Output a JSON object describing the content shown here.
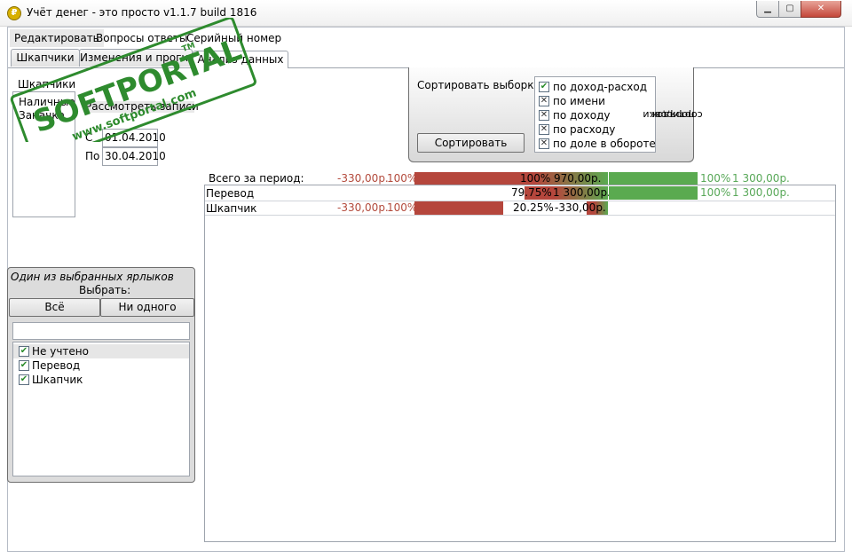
{
  "window": {
    "title": "Учёт денег - это просто v1.1.7 build 1816",
    "controls": {
      "minimize": "▁",
      "maximize": "▢",
      "close": "✕"
    }
  },
  "menu": [
    "Редактировать",
    "Вопросы ответы",
    "Серийный номер"
  ],
  "tabs": [
    {
      "label": "Шкапчики",
      "active": false
    },
    {
      "label": "Изменения и прогноз",
      "active": false
    },
    {
      "label": "Анализ данных",
      "active": true
    }
  ],
  "left_top": {
    "cards_header": "Шкапчики",
    "cards": [
      "Наличные",
      "Заначка"
    ],
    "view_label": "Рассмотреть записи",
    "from_label": "С",
    "from_value": "01.04.2010",
    "to_label": "По",
    "to_value": "30.04.2010"
  },
  "filter": {
    "title": "Один из выбранных ярлыков",
    "subtitle": "Выбрать:",
    "all_button": "Всё",
    "none_button": "Ни одного",
    "search_value": "",
    "items": [
      {
        "label": "Не учтено",
        "checked": true
      },
      {
        "label": "Перевод",
        "checked": true
      },
      {
        "label": "Шкапчик",
        "checked": true
      }
    ]
  },
  "sort": {
    "title": "Сортировать выборку",
    "button": "Сортировать",
    "options": [
      {
        "label": "по доход-расход",
        "state": "checked"
      },
      {
        "label": "по имени",
        "state": "crossed"
      },
      {
        "label": "по доходу",
        "state": "crossed"
      },
      {
        "label": "по расходу",
        "state": "crossed"
      },
      {
        "label": "по доле в обороте",
        "state": "crossed"
      }
    ],
    "order_label_1": "порядок",
    "order_label_2": "сортировки"
  },
  "table": {
    "total": {
      "name": "Всего за период:",
      "expense": "-330,00р.",
      "expense_pct": "100%",
      "share_pct": "100%",
      "balance": "970,00р.",
      "income_pct": "100%",
      "income": "1 300,00р."
    },
    "rows": [
      {
        "name": "Перевод",
        "expense": "",
        "expense_pct": "",
        "share_pct": "79.75%",
        "balance": "1 300,00р.",
        "income_pct": "100%",
        "income": "1 300,00р.",
        "share_fraction": 0.7975
      },
      {
        "name": "Шкапчик",
        "expense": "-330,00р.",
        "expense_pct": "100%",
        "share_pct": "20.25%",
        "balance": "-330,00р.",
        "income_pct": "",
        "income": "",
        "share_fraction": 0.2025
      }
    ]
  },
  "colors": {
    "expense_bar": "#b5463c",
    "income_bar": "#5aaa50",
    "negative_text": "#b34a3c",
    "positive_text": "#58a858",
    "watermark": "#2e8b2e"
  },
  "watermark": {
    "brand": "SOFTPORTAL",
    "url": "www.softportal.com",
    "tm": "TM"
  }
}
